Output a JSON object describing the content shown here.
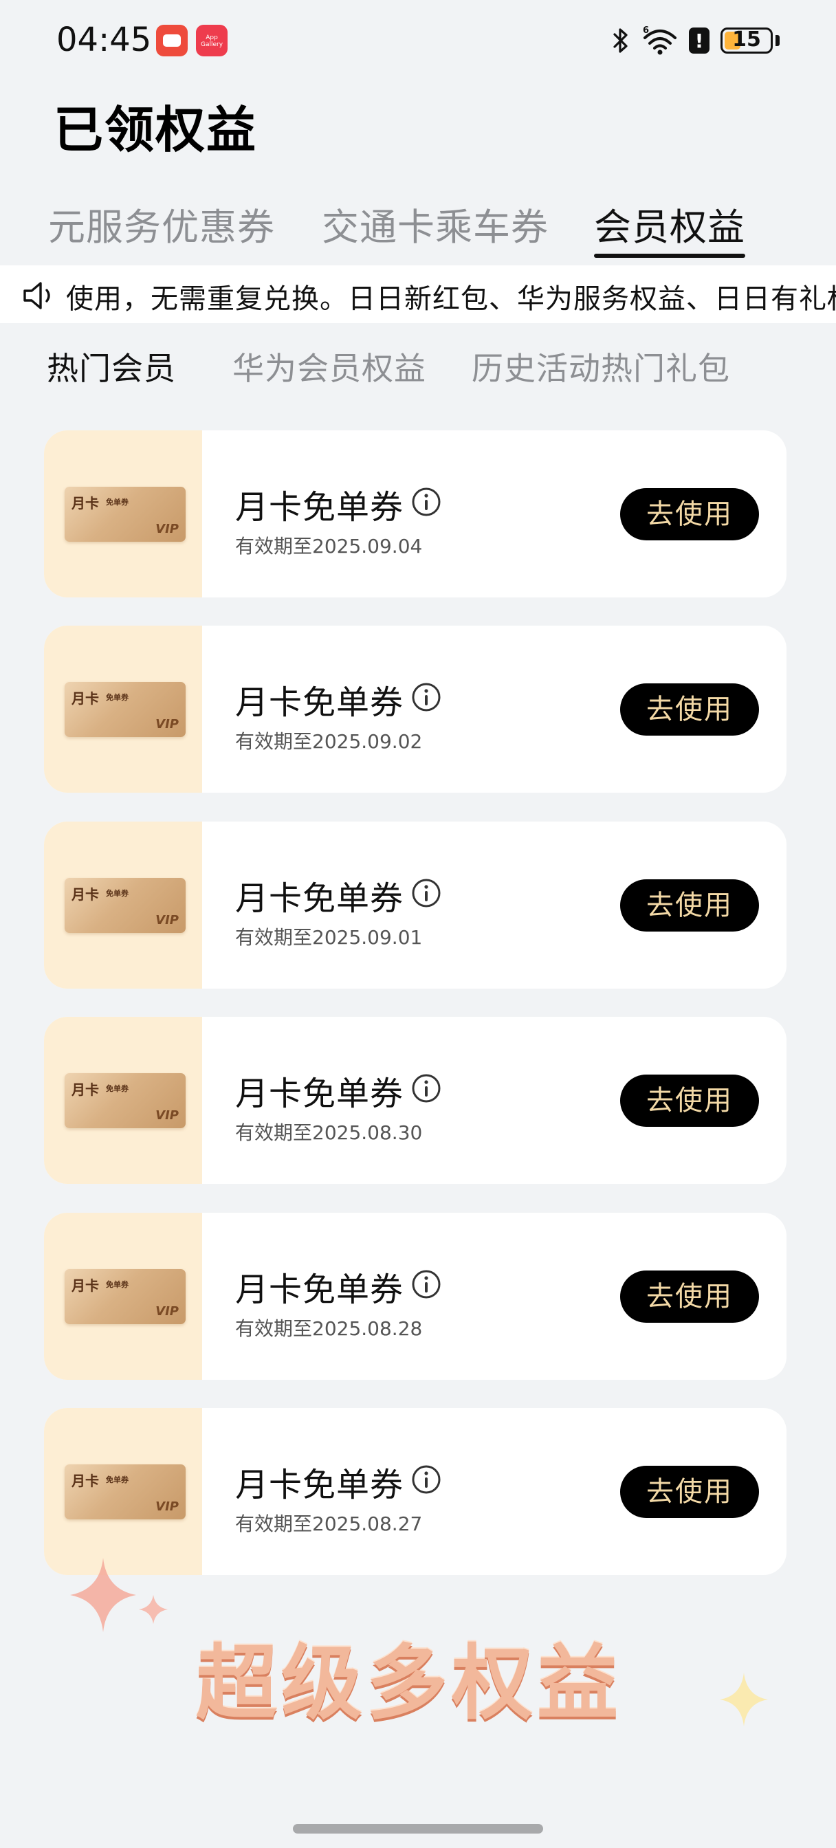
{
  "status_bar": {
    "time": "04:45",
    "app_badge_2_text": "App Gallery",
    "battery": "15",
    "battery_level": 0.15,
    "icons": [
      "bluetooth-icon",
      "wifi-6-icon",
      "warning-icon",
      "battery-icon"
    ]
  },
  "page": {
    "title": "已领权益"
  },
  "main_tabs": [
    {
      "label": "元服务优惠券"
    },
    {
      "label": "交通卡乘车券"
    },
    {
      "label": "会员权益"
    }
  ],
  "active_main_tab": 2,
  "marquee": {
    "icon": "speaker-icon",
    "text": "使用，无需重复兑换。日日新红包、华为服务权益、日日有礼权"
  },
  "sub_tabs": [
    {
      "label": "热门会员"
    },
    {
      "label": "华为会员权益"
    },
    {
      "label": "历史活动热门礼包"
    }
  ],
  "active_sub_tab": 0,
  "coupons": [
    {
      "title": "月卡免单券",
      "expiry": "有效期至2025.09.04",
      "button": "去使用",
      "card_title": "月卡",
      "card_sub": "免单券",
      "card_badge": "VIP"
    },
    {
      "title": "月卡免单券",
      "expiry": "有效期至2025.09.02",
      "button": "去使用",
      "card_title": "月卡",
      "card_sub": "免单券",
      "card_badge": "VIP"
    },
    {
      "title": "月卡免单券",
      "expiry": "有效期至2025.09.01",
      "button": "去使用",
      "card_title": "月卡",
      "card_sub": "免单券",
      "card_badge": "VIP"
    },
    {
      "title": "月卡免单券",
      "expiry": "有效期至2025.08.30",
      "button": "去使用",
      "card_title": "月卡",
      "card_sub": "免单券",
      "card_badge": "VIP"
    },
    {
      "title": "月卡免单券",
      "expiry": "有效期至2025.08.28",
      "button": "去使用",
      "card_title": "月卡",
      "card_sub": "免单券",
      "card_badge": "VIP"
    },
    {
      "title": "月卡免单券",
      "expiry": "有效期至2025.08.27",
      "button": "去使用",
      "card_title": "月卡",
      "card_sub": "免单券",
      "card_badge": "VIP"
    }
  ],
  "promo": {
    "text": "超级多权益"
  },
  "colors": {
    "background": "#f1f3f5",
    "button_bg": "#000000",
    "button_text": "#f3d9a6",
    "thumb_bg": "#fdeed4",
    "battery_fill": "#ffb43b",
    "promo": "#f2b89b"
  }
}
